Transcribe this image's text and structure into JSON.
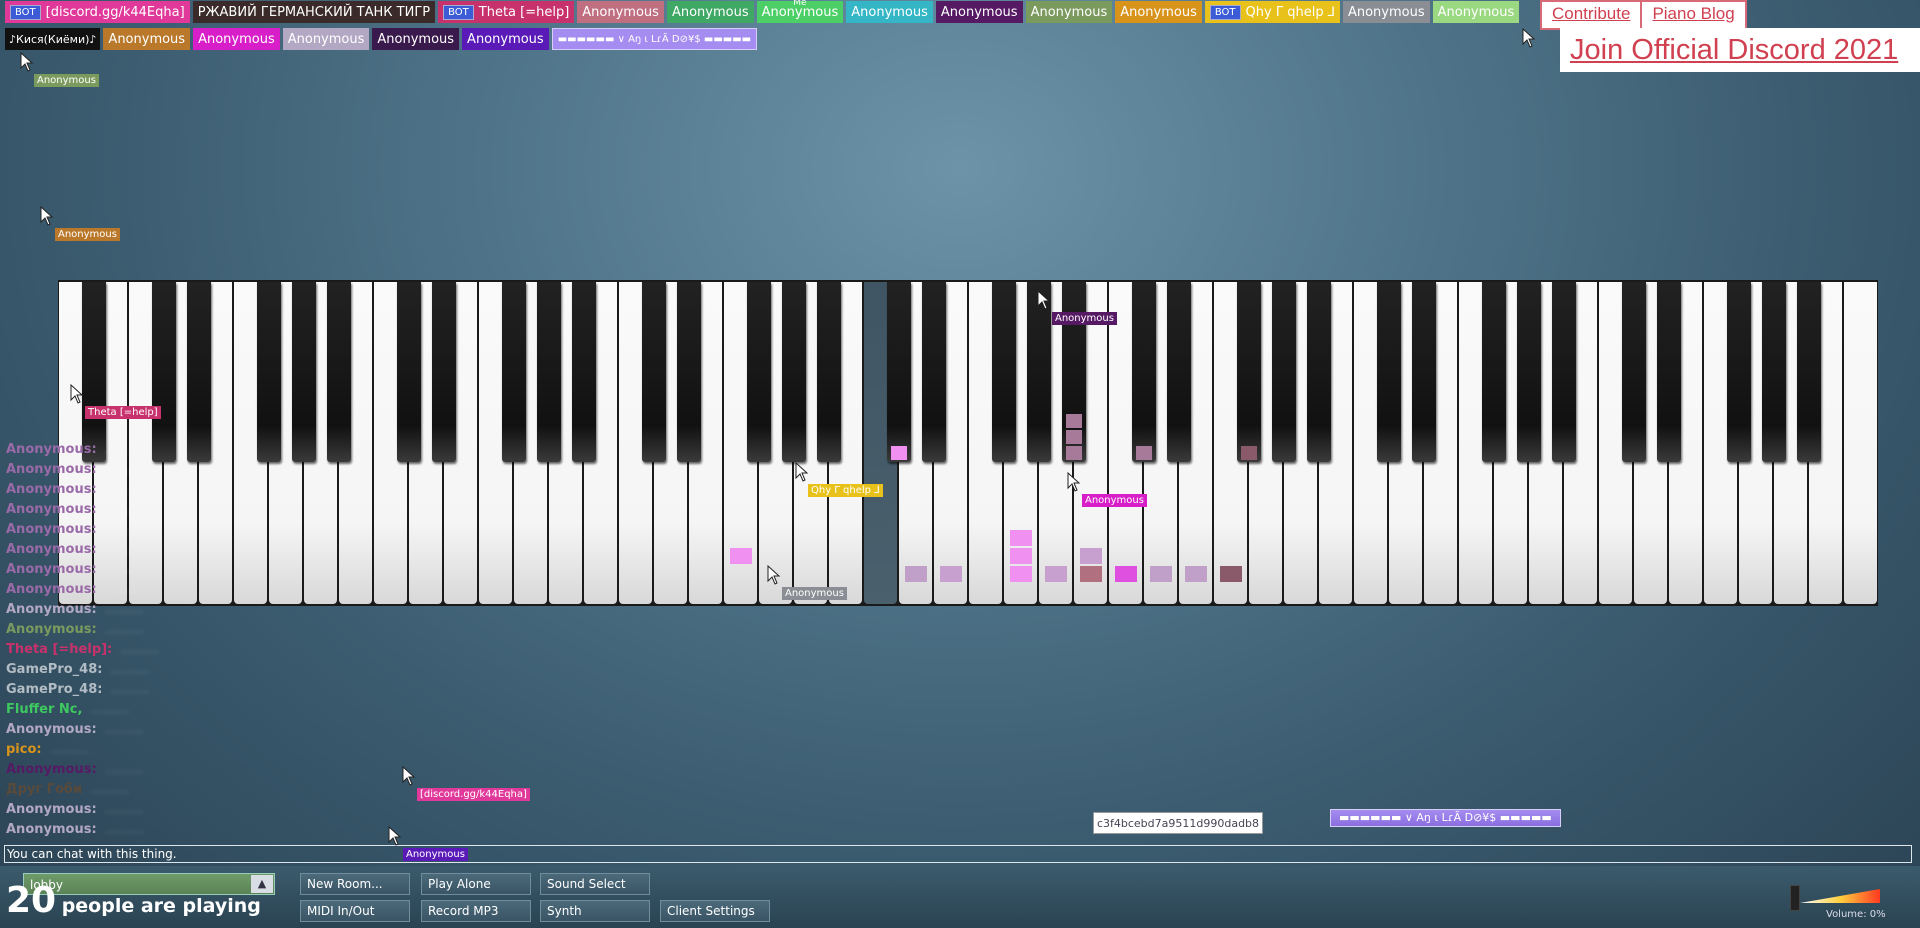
{
  "users_row1": [
    {
      "label": "[discord.gg/k44Eqha]",
      "bg": "#e0399a",
      "bot": true
    },
    {
      "label": "РЖАВИЙ ГЕРМАНСКИЙ ТАНК ТИГР",
      "bg": "#3a2a2a",
      "bot": false
    },
    {
      "label": "Theta [=help]",
      "bg": "#c8326c",
      "bot": true
    },
    {
      "label": "Anonymous",
      "bg": "#c06f80",
      "bot": false
    },
    {
      "label": "Anonymous",
      "bg": "#3ea864",
      "bot": false
    },
    {
      "label": "Anonymous",
      "bg": "#4ccf66",
      "bot": false,
      "me": true
    },
    {
      "label": "Anonymous",
      "bg": "#34b6c6",
      "bot": false
    },
    {
      "label": "Anonymous",
      "bg": "#561a64",
      "bot": false
    },
    {
      "label": "Anonymous",
      "bg": "#7a9a5e",
      "bot": false
    },
    {
      "label": "Anonymous",
      "bg": "#d8941a",
      "bot": false
    },
    {
      "label": "Qhy Γ qhelp ⅃",
      "bg": "#e8c21a",
      "bot": true
    },
    {
      "label": "Anonymous",
      "bg": "#8a8e94",
      "bot": false
    },
    {
      "label": "Anonymous",
      "bg": "#9ad882",
      "bot": false
    }
  ],
  "users_row2": [
    {
      "label": "♪Кися(Киёми)♪",
      "bg": "#111111",
      "stacked": true
    },
    {
      "label": "Anonymous",
      "bg": "#b9782a"
    },
    {
      "label": "Anonymous",
      "bg": "#d81ec8"
    },
    {
      "label": "Anonymous",
      "bg": "#b2a8c4"
    },
    {
      "label": "Anonymous",
      "bg": "#3a1a4c"
    },
    {
      "label": "Anonymous",
      "bg": "#5a1ab8"
    },
    {
      "label": "▬▬▬▬▬▬ ∨ Aŋ ι LɾÃ D⊘¥$ ▬▬▬▬▬",
      "bg": "#a58cf0",
      "fancy": true
    }
  ],
  "links": {
    "contribute": "Contribute",
    "blog": "Piano Blog",
    "discord": "Join Official Discord 2021"
  },
  "cursors": [
    {
      "name": "Anonymous",
      "bg": "#7a9a5e"
    },
    {
      "name": "Anonymous",
      "bg": "#b9782a"
    },
    {
      "name": "Theta [=help]",
      "bg": "#c8326c"
    },
    {
      "name": "Anonymous",
      "bg": "#561a64"
    },
    {
      "name": "Qhy Γ qhelp ⅃",
      "bg": "#e8c21a"
    },
    {
      "name": "Anonymous",
      "bg": "#d81ec8"
    },
    {
      "name": "Anonymous",
      "bg": "#8a8e94"
    },
    {
      "name": "[discord.gg/k44Eqha]",
      "bg": "#e0399a"
    },
    {
      "name": "Anonymous",
      "bg": "#5a1ab8"
    },
    {
      "name": "Anonymous",
      "bg": "#b2a8c4"
    }
  ],
  "chat": [
    {
      "name": "Anonymous:",
      "color": "#9a6aa8",
      "msg": "………"
    },
    {
      "name": "Anonymous:",
      "color": "#9a6aa8",
      "msg": "………"
    },
    {
      "name": "Anonymous:",
      "color": "#9a6aa8",
      "msg": "………"
    },
    {
      "name": "Anonymous:",
      "color": "#9a6aa8",
      "msg": "………"
    },
    {
      "name": "Anonymous:",
      "color": "#9a6aa8",
      "msg": "………"
    },
    {
      "name": "Anonymous:",
      "color": "#9a6aa8",
      "msg": "………"
    },
    {
      "name": "Anonymous:",
      "color": "#9a6aa8",
      "msg": "………"
    },
    {
      "name": "Anonymous:",
      "color": "#9a6aa8",
      "msg": "………"
    },
    {
      "name": "Anonymous:",
      "color": "#b2a8c4",
      "msg": "………"
    },
    {
      "name": "Anonymous:",
      "color": "#7a9a5e",
      "msg": "………"
    },
    {
      "name": "Theta [=help]:",
      "color": "#c8326c",
      "msg": "………"
    },
    {
      "name": "GamePro_48:",
      "color": "#b2bcc4",
      "msg": "………"
    },
    {
      "name": "GamePro_48:",
      "color": "#b2bcc4",
      "msg": "………"
    },
    {
      "name": "Fluffer Nc,",
      "color": "#3ec860",
      "msg": "………"
    },
    {
      "name": "Anonymous:",
      "color": "#b2a8c4",
      "msg": "………"
    },
    {
      "name": "pico:",
      "color": "#d8941a",
      "msg": "………"
    },
    {
      "name": "Anonymous:",
      "color": "#561a64",
      "msg": "………"
    },
    {
      "name": "Друг Гоби",
      "color": "#5a4a3a",
      "msg": "………"
    },
    {
      "name": "Anonymous:",
      "color": "#b2a8c4",
      "msg": "………"
    },
    {
      "name": "Anonymous:",
      "color": "#b2a8c4",
      "msg": "………"
    }
  ],
  "chat_placeholder": "You can chat with this thing.",
  "hash": "c3f4bcebd7a9511d990dadb8",
  "fancy_label": "▬▬▬▬▬▬ ∨ Aŋ ι LɾÃ D⊘¥$ ▬▬▬▬▬",
  "room": {
    "name": "lobby",
    "arrow": "▲"
  },
  "buttons": {
    "new_room": "New Room...",
    "play_alone": "Play Alone",
    "sound_select": "Sound Select",
    "midi": "MIDI In/Out",
    "record": "Record MP3",
    "synth": "Synth",
    "client_settings": "Client Settings"
  },
  "player_count": "20",
  "player_text": "people are playing",
  "volume": {
    "label": "Volume: 0%",
    "level": 0
  },
  "note_colors": [
    "#b89ac0",
    "#c8a0d0",
    "#e050e0",
    "#d8a0c8",
    "#b07080",
    "#f090f0",
    "#c0a0c8",
    "#a87a9a",
    "#8a5a6a",
    "#b8a0d0"
  ]
}
